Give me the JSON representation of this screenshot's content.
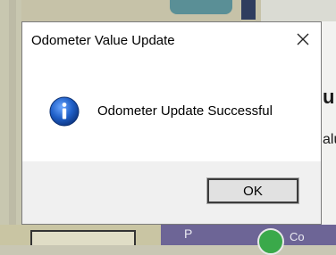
{
  "dialog": {
    "title": "Odometer Value Update",
    "message": "Odometer Update Successful",
    "ok_label": "OK",
    "close_icon": "close-icon",
    "info_icon": "info-icon"
  },
  "background": {
    "right_heading_fragment": "u",
    "right_text_fragment": "alu",
    "bottom_tab_fragment": "P",
    "bottom_right_fragment": "Co"
  },
  "colors": {
    "dialog_bg": "#ffffff",
    "footer_bg": "#f0f0f0",
    "button_bg": "#e1e1e1",
    "info_blue": "#1f5fc7"
  }
}
